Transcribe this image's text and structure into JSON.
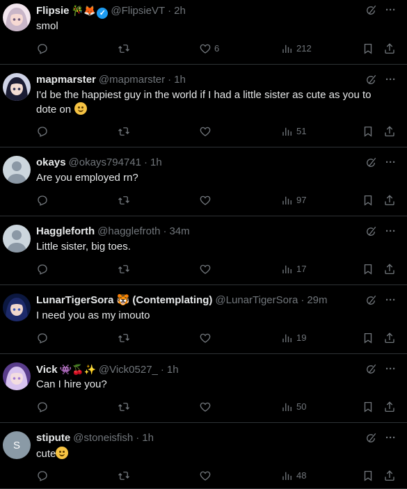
{
  "colors": {
    "background": "#000000",
    "text": "#e7e9ea",
    "muted": "#71767b",
    "border": "#2f3336",
    "verified": "#1d9bf0"
  },
  "replies": [
    {
      "name": "Flipsie",
      "name_emojis": "🎋🦊",
      "verified": true,
      "handle": "@FlipsieVT",
      "time": "2h",
      "text": "smol",
      "likes": "6",
      "views": "212",
      "avatar": "anime-pink"
    },
    {
      "name": "mapmarster",
      "name_emojis": "",
      "verified": false,
      "handle": "@mapmarster",
      "time": "1h",
      "text": "I'd be the happiest guy in the world if I had a little sister as cute as you to dote on",
      "text_emoji": "smiling-hearts-emoji",
      "likes": "",
      "views": "51",
      "avatar": "anime-dark"
    },
    {
      "name": "okays",
      "name_emojis": "",
      "verified": false,
      "handle": "@okays794741",
      "time": "1h",
      "text": "Are you employed rn?",
      "likes": "",
      "views": "97",
      "avatar": "default"
    },
    {
      "name": "Haggleforth",
      "name_emojis": "",
      "verified": false,
      "handle": "@hagglefroth",
      "time": "34m",
      "text": "Little sister, big toes.",
      "likes": "",
      "views": "17",
      "avatar": "default"
    },
    {
      "name": "LunarTigerSora 🐯 (Contemplating)",
      "name_emojis": "",
      "verified": false,
      "handle": "@LunarTigerSora",
      "time": "29m",
      "text": "I need you as my imouto",
      "likes": "",
      "views": "19",
      "avatar": "anime-blue"
    },
    {
      "name": "Vick",
      "name_emojis": "👾🍒✨",
      "verified": false,
      "handle": "@Vick0527_",
      "time": "1h",
      "text": "Can I hire you?",
      "likes": "",
      "views": "50",
      "avatar": "anime-purple"
    },
    {
      "name": "stipute",
      "name_emojis": "",
      "verified": false,
      "handle": "@stoneisfish",
      "time": "1h",
      "text": "cute",
      "text_emoji": "smiling-emoji",
      "likes": "",
      "views": "48",
      "avatar": "letter",
      "avatar_letter": "S"
    }
  ],
  "dot": "·",
  "more": "···"
}
